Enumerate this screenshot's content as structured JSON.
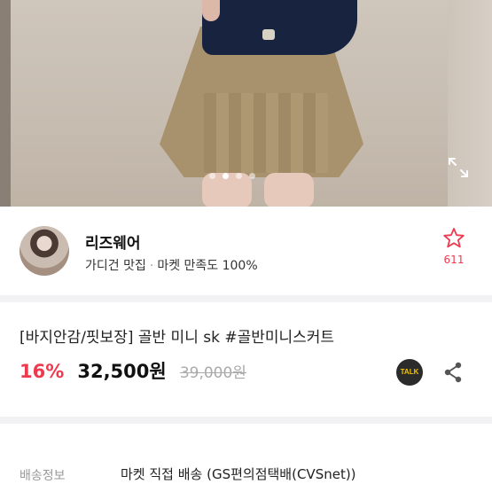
{
  "gallery": {
    "image_count": 4,
    "active_index": 1
  },
  "seller": {
    "name": "리즈웨어",
    "tagline": "가디건 맛집",
    "separator": "·",
    "rating_text": "마켓 만족도 100%"
  },
  "favorite": {
    "count": "611",
    "color": "#ee3a4f"
  },
  "product": {
    "title": "[바지안감/핏보장] 골반 미니 sk #골반미니스커트",
    "discount": "16%",
    "price": "32,500원",
    "original_price": "39,000원"
  },
  "talk_badge": {
    "label": "TALK"
  },
  "shipping": {
    "label": "배송정보",
    "value": "마켓 직접 배송 (GS편의점택배(CVSnet))"
  },
  "icons": [
    "expand-icon",
    "star-icon",
    "talk-icon",
    "share-icon"
  ],
  "colors": {
    "accent": "#ee3a4f",
    "divider": "#f2f2f4"
  }
}
